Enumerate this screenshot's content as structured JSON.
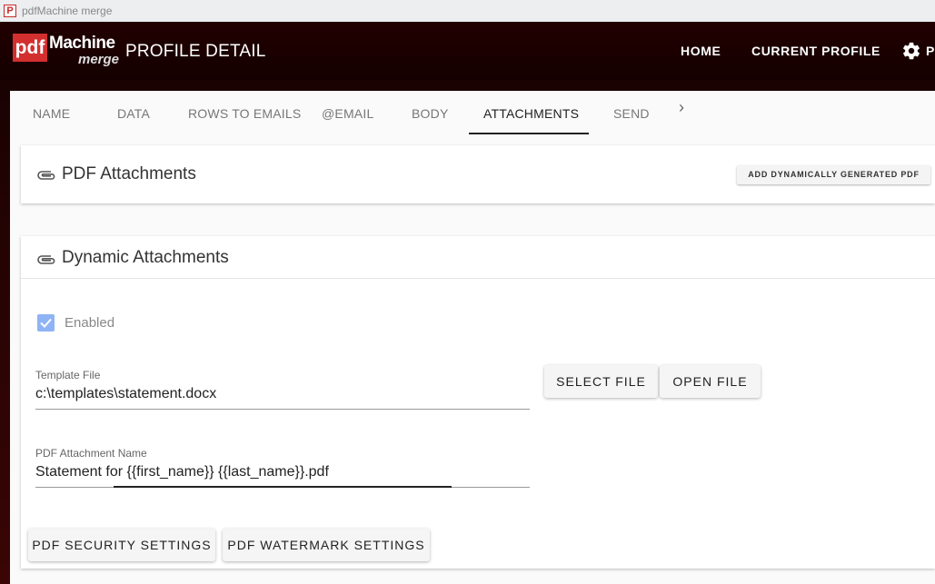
{
  "window": {
    "title": "pdfMachine merge",
    "icon": "pdfmachine-app-icon"
  },
  "logo": {
    "pdf": "pdf",
    "machine": "Machine",
    "merge": "merge"
  },
  "header": {
    "page_title": "PROFILE DETAIL",
    "nav": {
      "home": "HOME",
      "current_profile": "CURRENT PROFILE",
      "settings_partial": "P"
    }
  },
  "tabs": [
    {
      "label": "NAME"
    },
    {
      "label": "DATA"
    },
    {
      "label": "ROWS TO EMAILS"
    },
    {
      "label": "@EMAIL"
    },
    {
      "label": "BODY"
    },
    {
      "label": "ATTACHMENTS",
      "active": true
    },
    {
      "label": "SEND"
    }
  ],
  "pdf_attachments": {
    "title": "PDF Attachments",
    "add_button": "ADD DYNAMICALLY GENERATED PDF"
  },
  "dynamic_attachments": {
    "title": "Dynamic Attachments",
    "enabled_label": "Enabled",
    "enabled": true,
    "template_file": {
      "label": "Template File",
      "value": "c:\\templates\\statement.docx"
    },
    "select_file": "SELECT FILE",
    "open_file": "OPEN FILE",
    "attachment_name": {
      "label": "PDF Attachment Name",
      "value": "Statement for {{first_name}} {{last_name}}.pdf"
    },
    "security_button": "PDF SECURITY SETTINGS",
    "watermark_button": "PDF WATERMARK SETTINGS"
  },
  "colors": {
    "appbar": "#1a0000",
    "accent": "#8fb4f5",
    "logo_red": "#d32f2f"
  }
}
